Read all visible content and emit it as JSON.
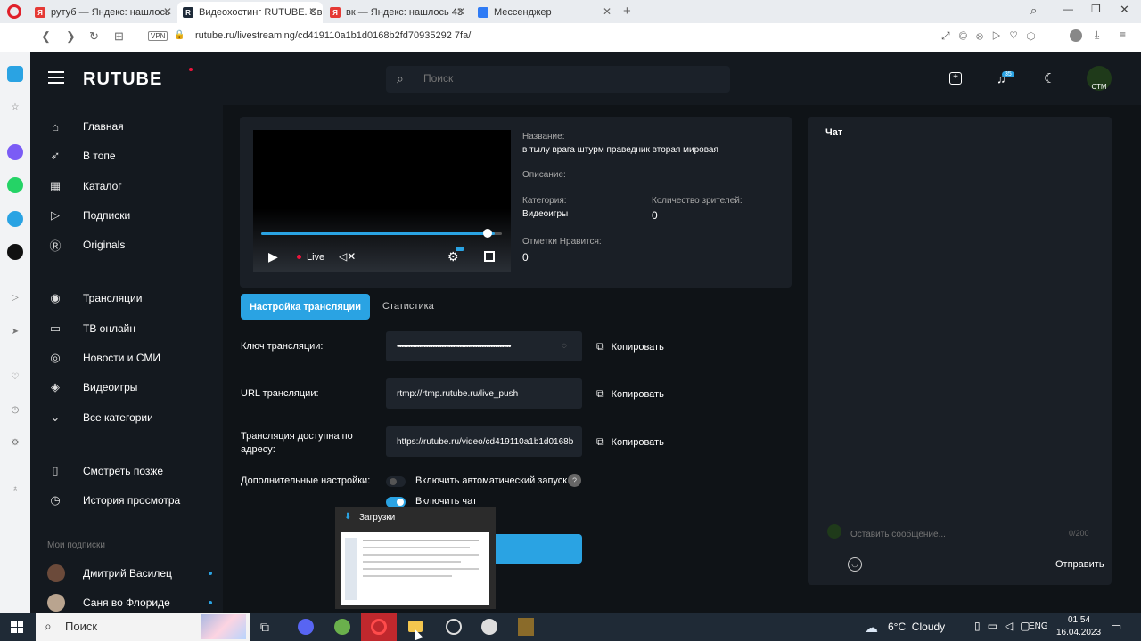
{
  "browser": {
    "tabs": [
      {
        "title": "рутуб — Яндекс: нашлось",
        "icon_letter": "Я",
        "color": "#e53935",
        "active": false
      },
      {
        "title": "Видеохостинг RUTUBE. Св",
        "icon_letter": "R",
        "color": "#1e2a38",
        "active": true
      },
      {
        "title": "вк — Яндекс: нашлось 43",
        "icon_letter": "Я",
        "color": "#e53935",
        "active": false
      },
      {
        "title": "Мессенджер",
        "icon_letter": "",
        "color": "#2f7bf5",
        "active": false
      }
    ],
    "url": "rutube.ru/livestreaming/cd419110a1b1d0168b2fd70935292 7fa/",
    "vpn_label": "VPN"
  },
  "header": {
    "logo": "RUTUBE",
    "search_placeholder": "Поиск",
    "notifications_count": "35",
    "avatar_text": "СТМ"
  },
  "sidebar": {
    "items": [
      {
        "label": "Главная",
        "icon": "home-icon",
        "glyph": "⌂"
      },
      {
        "label": "В топе",
        "icon": "rocket-icon",
        "glyph": "➶"
      },
      {
        "label": "Каталог",
        "icon": "catalog-icon",
        "glyph": "▦"
      },
      {
        "label": "Подписки",
        "icon": "subscriptions-icon",
        "glyph": "▷"
      },
      {
        "label": "Originals",
        "icon": "originals-icon",
        "glyph": "Ⓡ"
      },
      {
        "label": "Трансляции",
        "icon": "broadcast-icon",
        "glyph": "◉"
      },
      {
        "label": "ТВ онлайн",
        "icon": "tv-icon",
        "glyph": "▭"
      },
      {
        "label": "Новости и СМИ",
        "icon": "globe-icon",
        "glyph": "◎"
      },
      {
        "label": "Видеоигры",
        "icon": "gamepad-icon",
        "glyph": "◈"
      },
      {
        "label": "Все категории",
        "icon": "chevron-down-icon",
        "glyph": "⌄"
      },
      {
        "label": "Смотреть позже",
        "icon": "bookmark-icon",
        "glyph": "▯"
      },
      {
        "label": "История просмотра",
        "icon": "history-icon",
        "glyph": "◷"
      }
    ],
    "subscriptions_heading": "Мои подписки",
    "subscriptions": [
      "Дмитрий Василец",
      "Саня во Флориде"
    ]
  },
  "player": {
    "live_label": "Live",
    "progress": 0.97
  },
  "stream_info": {
    "name_label": "Название:",
    "name_value": "в тылу врага штурм праведник вторая мировая",
    "description_label": "Описание:",
    "category_label": "Категория:",
    "category_value": "Видеоигры",
    "viewers_label": "Количество зрителей:",
    "viewers_value": "0",
    "likes_label": "Отметки Нравится:",
    "likes_value": "0"
  },
  "tabs": {
    "settings": "Настройка трансляции",
    "stats": "Статистика"
  },
  "fields": {
    "key_label": "Ключ трансляции:",
    "key_value": "•••••••••••••••••••••••••••••••••••••••••••••••••••",
    "url_label": "URL трансляции:",
    "url_value": "rtmp://rtmp.rutube.ru/live_push",
    "address_label": "Трансляция доступна по адресу:",
    "address_value": "https://rutube.ru/video/cd419110a1b1d0168b",
    "copy_label": "Копировать",
    "extra_label": "Дополнительные настройки:",
    "auto_start_label": "Включить автоматический запуск",
    "chat_toggle_label": "Включить чат"
  },
  "chat": {
    "title": "Чат",
    "input_placeholder": "Оставить сообщение...",
    "counter": "0/200",
    "send_label": "Отправить"
  },
  "downloads_popup": {
    "title": "Загрузки"
  },
  "taskbar": {
    "search_placeholder": "Поиск",
    "weather": "6°C  Cloudy",
    "language": "ENG",
    "time": "01:54",
    "date": "16.04.2023"
  }
}
